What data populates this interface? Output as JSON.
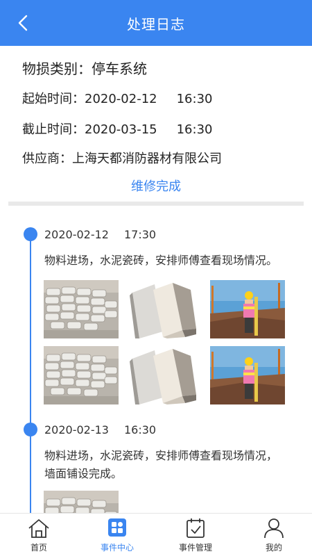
{
  "header": {
    "title": "处理日志"
  },
  "record": {
    "category": "物损类别：停车系统",
    "start_label": "起始时间：",
    "start_date": "2020-02-12",
    "start_time": "16:30",
    "end_label": "截止时间：",
    "end_date": "2020-03-15",
    "end_time": "16:30",
    "supplier": "供应商：上海天都消防器材有限公司",
    "status": "维修完成"
  },
  "timeline": [
    {
      "date": "2020-02-12",
      "time": "17:30",
      "text": "物料进场，水泥瓷砖，安排师傅查看现场情况。",
      "photos": [
        "cement-bags-photo",
        "tiles-photo",
        "surveyor-worker-photo",
        "cement-bags-photo",
        "tiles-photo",
        "surveyor-worker-photo"
      ]
    },
    {
      "date": "2020-02-13",
      "time": "16:30",
      "text_line1": "物料进场，水泥瓷砖，安排师傅查看现场情况，",
      "text_line2": "墙面铺设完成。",
      "photos": [
        "cement-bags-photo"
      ]
    }
  ],
  "nav": [
    {
      "label": "首页",
      "icon": "home-icon"
    },
    {
      "label": "事件中心",
      "icon": "event-center-icon",
      "active": true
    },
    {
      "label": "事件管理",
      "icon": "calendar-check-icon"
    },
    {
      "label": "我的",
      "icon": "user-icon"
    }
  ],
  "colors": {
    "primary": "#3a85f0",
    "divider": "#e9e9e9"
  }
}
